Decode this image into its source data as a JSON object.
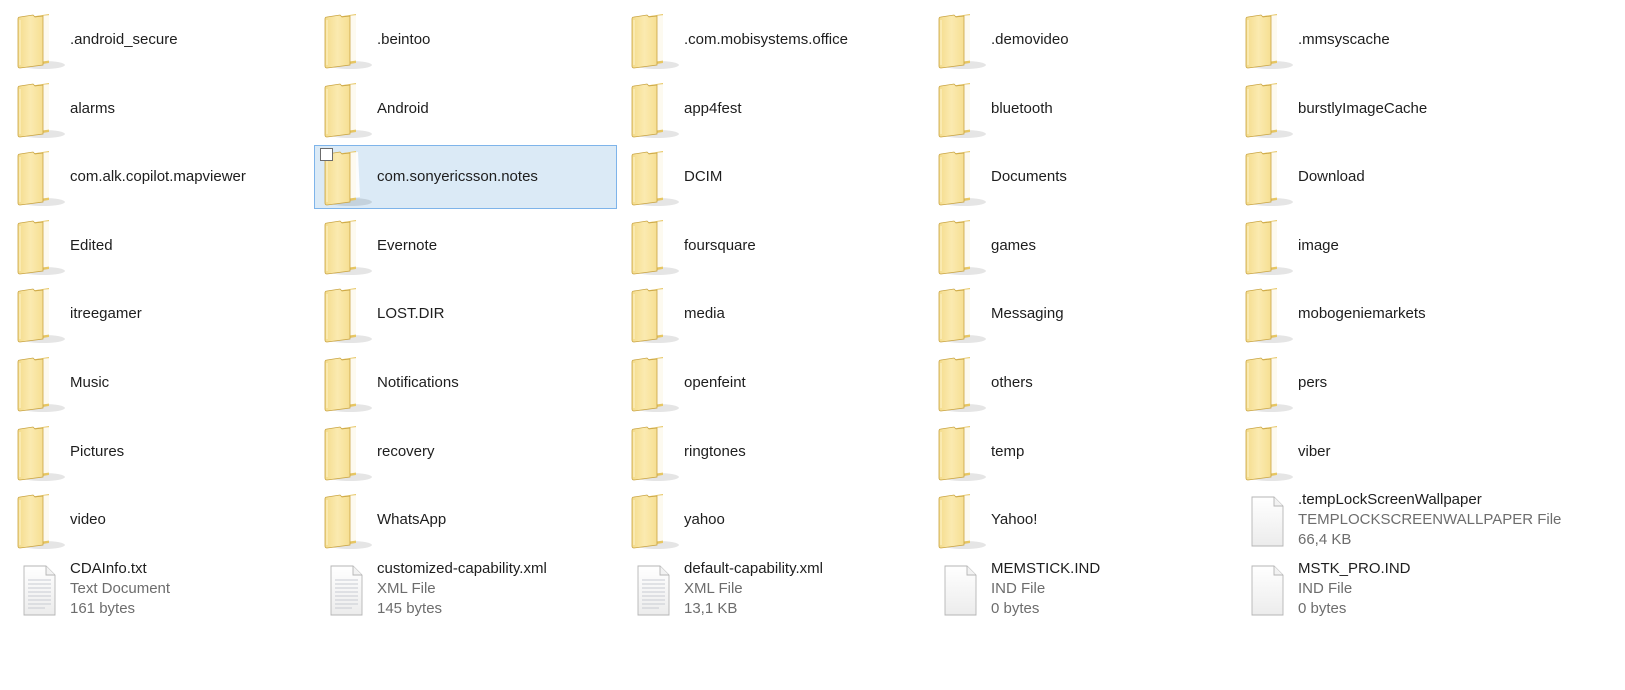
{
  "window": {
    "view": "Tiles"
  },
  "selected_index": 12,
  "items": [
    {
      "kind": "folder",
      "name": ".android_secure"
    },
    {
      "kind": "folder",
      "name": ".beintoo"
    },
    {
      "kind": "folder",
      "name": ".com.mobisystems.office"
    },
    {
      "kind": "folder",
      "name": ".demovideo"
    },
    {
      "kind": "folder",
      "name": ".mmsyscache"
    },
    {
      "kind": "folder",
      "name": "alarms"
    },
    {
      "kind": "folder",
      "name": "Android"
    },
    {
      "kind": "folder",
      "name": "app4fest"
    },
    {
      "kind": "folder",
      "name": "bluetooth"
    },
    {
      "kind": "folder",
      "name": "burstlyImageCache"
    },
    {
      "kind": "folder",
      "name": "com.alk.copilot.mapviewer"
    },
    {
      "kind": "folder",
      "name": "com.sonyericsson.notes"
    },
    {
      "kind": "folder",
      "name": "DCIM"
    },
    {
      "kind": "folder",
      "name": "Documents"
    },
    {
      "kind": "folder",
      "name": "Download"
    },
    {
      "kind": "folder",
      "name": "Edited"
    },
    {
      "kind": "folder",
      "name": "Evernote"
    },
    {
      "kind": "folder",
      "name": "foursquare"
    },
    {
      "kind": "folder",
      "name": "games"
    },
    {
      "kind": "folder",
      "name": "image"
    },
    {
      "kind": "folder",
      "name": "itreegamer"
    },
    {
      "kind": "folder",
      "name": "LOST.DIR"
    },
    {
      "kind": "folder",
      "name": "media"
    },
    {
      "kind": "folder",
      "name": "Messaging"
    },
    {
      "kind": "folder",
      "name": "mobogeniemarkets"
    },
    {
      "kind": "folder",
      "name": "Music"
    },
    {
      "kind": "folder",
      "name": "Notifications"
    },
    {
      "kind": "folder",
      "name": "openfeint"
    },
    {
      "kind": "folder",
      "name": "others"
    },
    {
      "kind": "folder",
      "name": "pers"
    },
    {
      "kind": "folder",
      "name": "Pictures"
    },
    {
      "kind": "folder",
      "name": "recovery"
    },
    {
      "kind": "folder",
      "name": "ringtones"
    },
    {
      "kind": "folder",
      "name": "temp"
    },
    {
      "kind": "folder",
      "name": "viber"
    },
    {
      "kind": "folder",
      "name": "video"
    },
    {
      "kind": "folder",
      "name": "WhatsApp"
    },
    {
      "kind": "folder",
      "name": "yahoo"
    },
    {
      "kind": "folder",
      "name": "Yahoo!"
    },
    {
      "kind": "file",
      "icon": "blank-file-icon",
      "name": ".tempLockScreenWallpaper",
      "type": "TEMPLOCKSCREENWALLPAPER File",
      "size": "66,4 KB"
    },
    {
      "kind": "file",
      "icon": "text-document-icon",
      "name": "CDAInfo.txt",
      "type": "Text Document",
      "size": "161 bytes"
    },
    {
      "kind": "file",
      "icon": "text-document-icon",
      "name": "customized-capability.xml",
      "type": "XML File",
      "size": "145 bytes"
    },
    {
      "kind": "file",
      "icon": "text-document-icon",
      "name": "default-capability.xml",
      "type": "XML File",
      "size": "13,1 KB"
    },
    {
      "kind": "file",
      "icon": "blank-file-icon",
      "name": "MEMSTICK.IND",
      "type": "IND File",
      "size": "0 bytes"
    },
    {
      "kind": "file",
      "icon": "blank-file-icon",
      "name": "MSTK_PRO.IND",
      "type": "IND File",
      "size": "0 bytes"
    }
  ]
}
